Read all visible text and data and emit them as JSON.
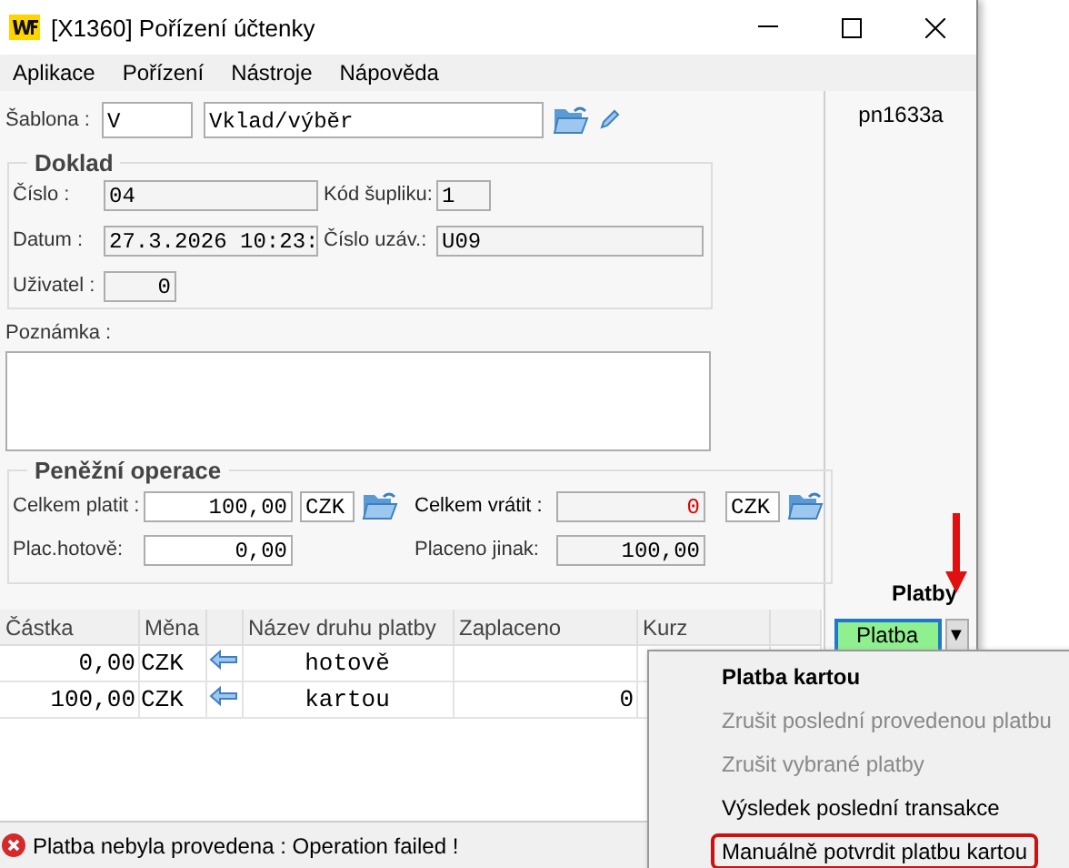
{
  "window": {
    "title": "[X1360] Pořízení účtenky"
  },
  "menu": [
    "Aplikace",
    "Pořízení",
    "Nástroje",
    "Nápověda"
  ],
  "template": {
    "label": "Šablona :",
    "code": "V",
    "name": "Vklad/výběr"
  },
  "doklad": {
    "title": "Doklad",
    "cislo": {
      "label": "Číslo :",
      "value": "04"
    },
    "kod_supliku": {
      "label": "Kód šupliku:",
      "value": "1"
    },
    "datum": {
      "label": "Datum :",
      "value": "27.3.2026 10:23:"
    },
    "cislo_uzav": {
      "label": "Číslo uzáv.:",
      "value": "U09"
    },
    "uzivatel": {
      "label": "Uživatel :",
      "value": "0"
    }
  },
  "note": {
    "label": "Poznámka :"
  },
  "money": {
    "title": "Peněžní operace",
    "celkem_platit": {
      "label": "Celkem platit :",
      "value": "100,00",
      "currency": "CZK"
    },
    "celkem_vratit": {
      "label": "Celkem vrátit :",
      "value": "0",
      "currency": "CZK",
      "alert": true
    },
    "plac_hotove": {
      "label": "Plac.hotově:",
      "value": "0,00"
    },
    "placeno_jinak": {
      "label": "Placeno jinak:",
      "value": "100,00"
    }
  },
  "table": {
    "columns": [
      "Částka",
      "Měna",
      "Název druhu platby",
      "Zaplaceno",
      "Kurz"
    ],
    "rows": [
      {
        "amount": "0,00",
        "currency": "CZK",
        "type": "hotově"
      },
      {
        "amount": "100,00",
        "currency": "CZK",
        "type": "kartou",
        "paid": "0"
      }
    ]
  },
  "side": {
    "code": "pn1633a",
    "title": "Platby",
    "button": "Platba",
    "dropdown": "▼"
  },
  "status_bar": {
    "message": "Platba nebyla provedena : Operation failed !"
  },
  "popup_menu": [
    {
      "label": "Platba kartou",
      "kind": "bold",
      "disabled": false,
      "highlighted": false
    },
    {
      "label": "Zrušit poslední provedenou platbu",
      "kind": "normal",
      "disabled": true,
      "highlighted": false
    },
    {
      "label": "Zrušit vybrané platby",
      "kind": "normal",
      "disabled": true,
      "highlighted": false
    },
    {
      "label": "Výsledek poslední transakce",
      "kind": "normal",
      "disabled": false,
      "highlighted": false
    },
    {
      "label": "Manuálně potvrdit platbu kartou",
      "kind": "normal",
      "disabled": false,
      "highlighted": true
    }
  ]
}
